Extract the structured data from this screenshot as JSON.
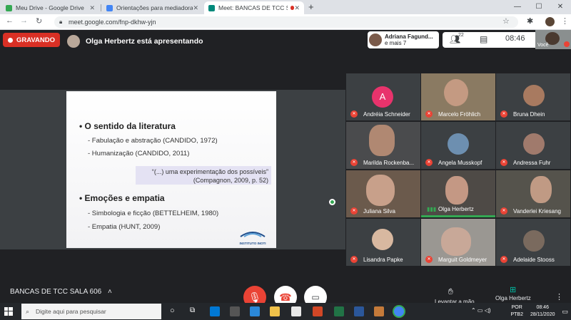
{
  "browser": {
    "tabs": [
      {
        "title": "Meu Drive - Google Drive",
        "color": "#34a853"
      },
      {
        "title": "Orientações para mediadoras - D",
        "color": "#4285f4"
      },
      {
        "title": "Meet: BANCAS DE TCC SALA",
        "color": "#00897b"
      }
    ],
    "url": "meet.google.com/fnp-dkhw-yjn"
  },
  "meet": {
    "recording_label": "GRAVANDO",
    "presenting_label": "Olga Herbertz está apresentando",
    "notice_name": "Adriana Fagund...",
    "notice_more": "e mais 7",
    "participants_count": "22",
    "time": "08:46",
    "self_label": "Você",
    "meeting_name": "BANCAS DE TCC SALA 606",
    "present_label": "Olga Herbertz",
    "raise_hand_label": "Levantar a mão"
  },
  "slide": {
    "heading1": "O sentido da literatura",
    "items1": [
      "- Fabulação e abstração (CANDIDO, 1972)",
      "- Humanização (CANDIDO, 2011)"
    ],
    "quote_line1": "“(...) uma experimentação dos possíveis”",
    "quote_line2": "(Compagnon, 2009, p. 52)",
    "heading2": "Emoções e empatia",
    "items2": [
      "- Simbologia e ficção (BETTELHEIM, 1980)",
      "- Empatia (HUNT, 2009)"
    ],
    "logo_text": "INSTITUTO INOTI"
  },
  "participants": [
    {
      "name": "Andréia Schneider",
      "initial": "A",
      "bg": "#3c4043"
    },
    {
      "name": "Marcelo Fröhlich",
      "bg": "#8a7a62"
    },
    {
      "name": "Bruna Dhein",
      "bg": "#3a3b3d"
    },
    {
      "name": "Marilda Rockenba...",
      "bg": "#4a4b4d"
    },
    {
      "name": "Angela Musskopf",
      "bg": "#3c4043"
    },
    {
      "name": "Andressa Fuhr",
      "bg": "#3a3b3d"
    },
    {
      "name": "Juliana Silva",
      "bg": "#6b5a4c"
    },
    {
      "name": "Olga Herbertz",
      "bg": "#4e4a46"
    },
    {
      "name": "Vanderlei Kriesang",
      "bg": "#55534c"
    },
    {
      "name": "Lisandra Papke",
      "bg": "#3c4043"
    },
    {
      "name": "Marguit Goldmeyer",
      "bg": "#9a9792"
    },
    {
      "name": "Adelaide Stooss",
      "bg": "#3c4043"
    }
  ],
  "taskbar": {
    "search_placeholder": "Digite aqui para pesquisar",
    "lang": "POR",
    "layout": "PTB2",
    "time": "08:46",
    "date": "28/11/2020"
  }
}
